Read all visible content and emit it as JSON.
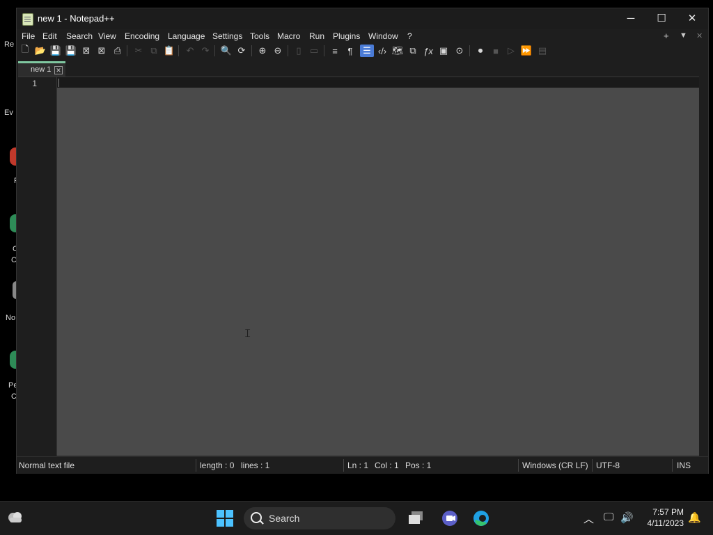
{
  "desktop": {
    "fragments": [
      "Re",
      "Ev",
      "F",
      "C",
      "C",
      "No",
      "Pe",
      "C"
    ]
  },
  "window": {
    "title": "new 1 - Notepad++",
    "controls": {
      "minimize": "─",
      "maximize": "☐",
      "close": "✕"
    }
  },
  "menu": {
    "items": [
      "File",
      "Edit",
      "Search",
      "View",
      "Encoding",
      "Language",
      "Settings",
      "Tools",
      "Macro",
      "Run",
      "Plugins",
      "Window",
      "?"
    ],
    "right": {
      "add": "+",
      "dropdown": "▼",
      "close": "✕"
    }
  },
  "toolbar": {
    "icons": [
      "new-file-icon",
      "open-file-icon",
      "save-icon",
      "save-all-icon",
      "close-icon",
      "close-all-icon",
      "print-icon",
      "cut-icon",
      "copy-icon",
      "paste-icon",
      "undo-icon",
      "redo-icon",
      "find-icon",
      "replace-icon",
      "zoom-in-icon",
      "zoom-out-icon",
      "sync-vertical-icon",
      "sync-horizontal-icon",
      "word-wrap-icon",
      "show-all-characters-icon",
      "indent-guide-icon",
      "xml-tag-icon",
      "document-map-icon",
      "document-list-icon",
      "function-list-icon",
      "monitoring-icon",
      "folder-as-workspace-icon",
      "record-macro-icon",
      "stop-record-icon",
      "play-macro-icon",
      "run-macro-multiple-icon",
      "save-macro-icon"
    ]
  },
  "tabs": [
    {
      "label": "new 1"
    }
  ],
  "editor": {
    "line_numbers": [
      "1"
    ],
    "content": ""
  },
  "status": {
    "file_type": "Normal text file",
    "length": "length : 0",
    "lines": "lines : 1",
    "ln": "Ln : 1",
    "col": "Col : 1",
    "pos": "Pos : 1",
    "eol": "Windows (CR LF)",
    "encoding": "UTF-8",
    "mode": "INS"
  },
  "taskbar": {
    "search_label": "Search",
    "time": "7:57 PM",
    "date": "4/11/2023"
  },
  "colors": {
    "accent": "#4a7bd6",
    "tab_accent": "#7fc7a0",
    "editor_bg": "#4a4a4a"
  }
}
